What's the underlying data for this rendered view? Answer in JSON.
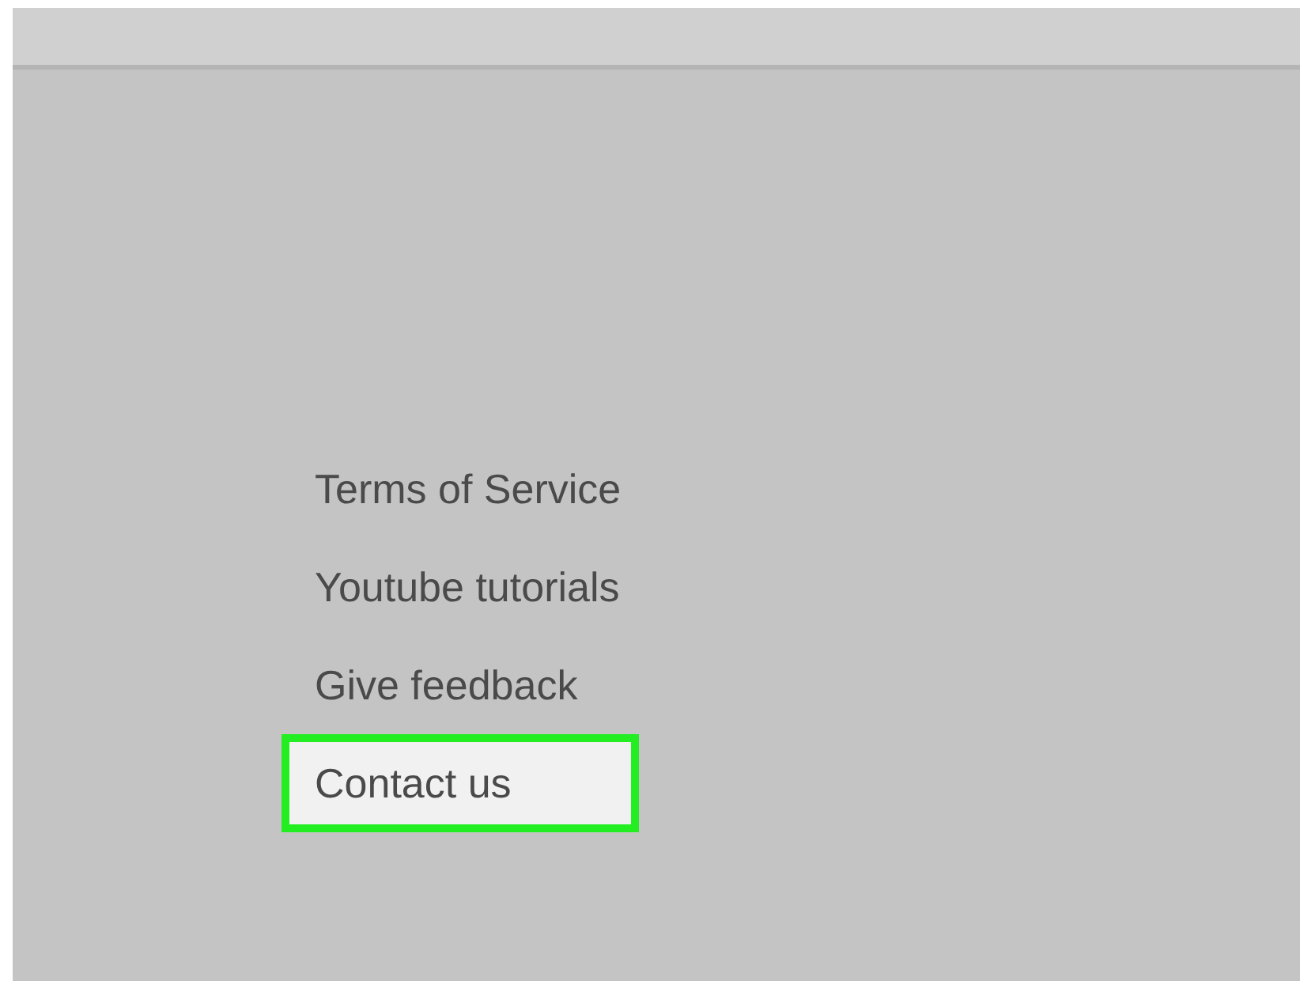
{
  "links": [
    {
      "label": "Terms of Service",
      "highlighted": false
    },
    {
      "label": "Youtube tutorials",
      "highlighted": false
    },
    {
      "label": "Give feedback",
      "highlighted": false
    },
    {
      "label": "Contact us",
      "highlighted": true
    }
  ]
}
